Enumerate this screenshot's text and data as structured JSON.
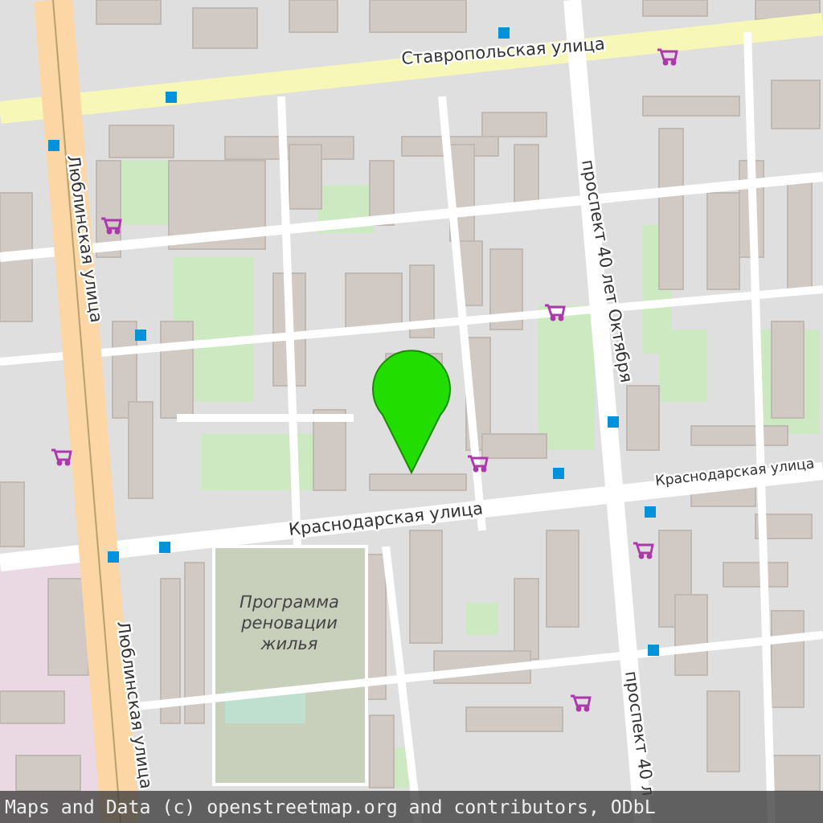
{
  "map": {
    "street_labels": [
      {
        "text": "Ставропольская улица"
      },
      {
        "text": "Люблинская улица"
      },
      {
        "text": "проспект 40 лет Октября"
      },
      {
        "text": "Краснодарская улица"
      },
      {
        "text": "Краснодарская улица"
      },
      {
        "text": "Люблинская улица"
      },
      {
        "text": "проспект 40 л"
      }
    ],
    "area_labels": [
      {
        "text": "Программа реновации жилья"
      }
    ],
    "pin": {
      "color": "#22dd00"
    }
  },
  "attribution": "Maps and Data (c) openstreetmap.org and contributors, ODbL"
}
